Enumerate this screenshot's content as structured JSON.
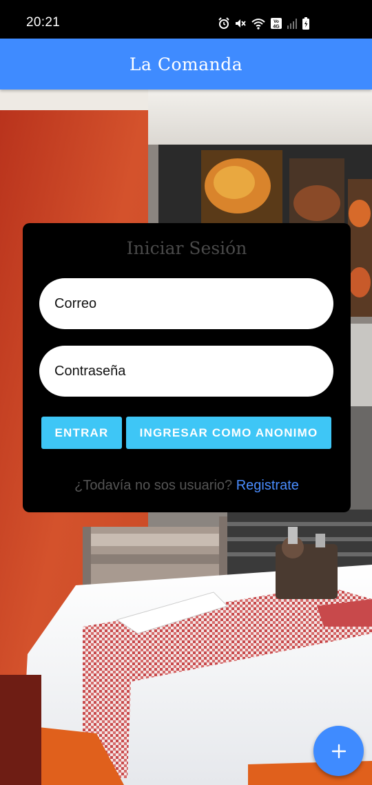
{
  "status_bar": {
    "time": "20:21",
    "icons": [
      "alarm-icon",
      "mute-icon",
      "wifi-icon",
      "volte-4g-icon",
      "signal-icon",
      "battery-icon"
    ]
  },
  "app_bar": {
    "title": "La Comanda"
  },
  "login_card": {
    "title": "Iniciar Sesión",
    "email_placeholder": "Correo",
    "password_placeholder": "Contraseña",
    "login_button": "ENTRAR",
    "anonymous_button": "INGRESAR COMO ANONIMO",
    "register_question": "¿Todavía no sos usuario?",
    "register_link": "Registrate"
  },
  "fab": {
    "icon": "plus-icon"
  },
  "colors": {
    "primary": "#3f8bff",
    "button": "#3ec6f6",
    "link": "#4a8dff",
    "card": "#000000"
  }
}
